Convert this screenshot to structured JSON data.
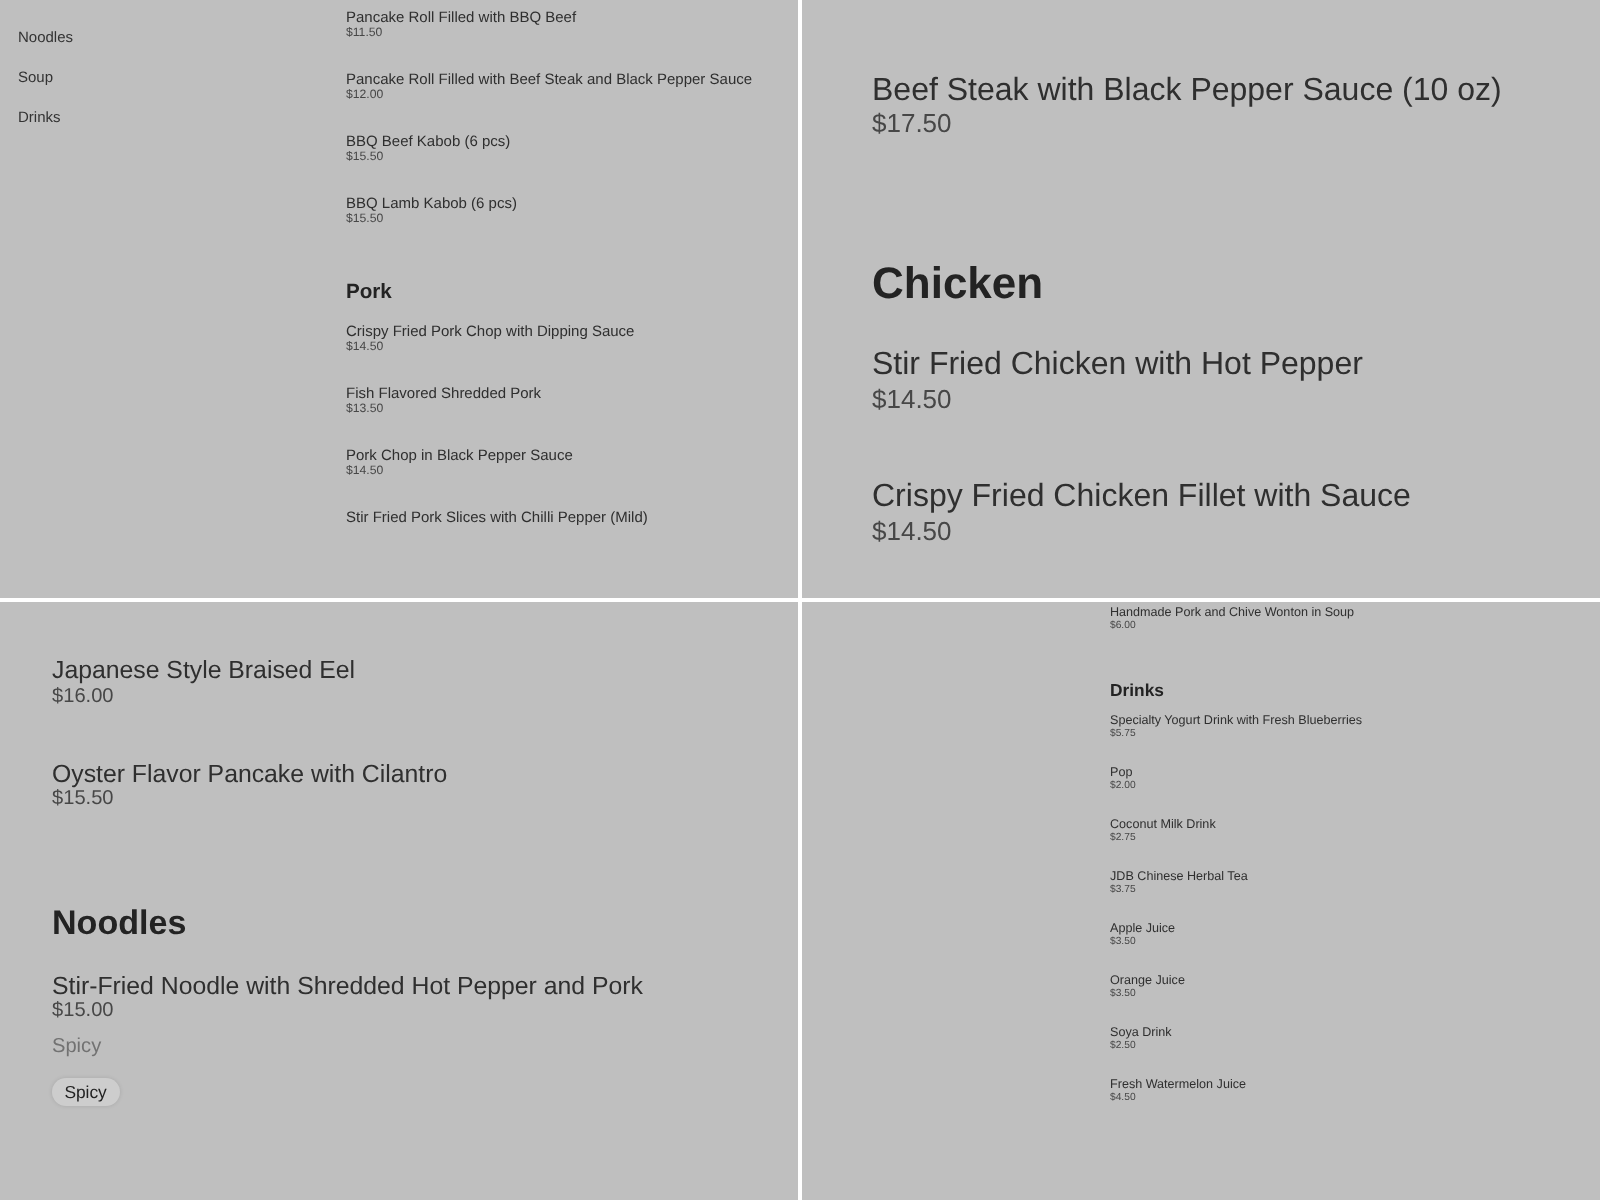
{
  "panels": [
    {
      "sidebar": {
        "items": [
          "Noodles",
          "Soup",
          "Drinks"
        ]
      },
      "sections": [
        {
          "items": [
            {
              "name": "Pancake Roll Filled with BBQ Beef",
              "price": "$11.50"
            },
            {
              "name": "Pancake Roll Filled with Beef Steak and Black Pepper Sauce",
              "price": "$12.00"
            },
            {
              "name": "BBQ Beef Kabob (6 pcs)",
              "price": "$15.50"
            },
            {
              "name": "BBQ Lamb Kabob (6 pcs)",
              "price": "$15.50"
            }
          ]
        },
        {
          "heading": "Pork",
          "items": [
            {
              "name": "Crispy Fried Pork Chop with Dipping Sauce",
              "price": "$14.50"
            },
            {
              "name": "Fish Flavored Shredded Pork",
              "price": "$13.50"
            },
            {
              "name": "Pork Chop in Black Pepper Sauce",
              "price": "$14.50"
            },
            {
              "name": "Stir Fried Pork Slices with Chilli Pepper (Mild)"
            }
          ]
        }
      ]
    },
    {
      "sections": [
        {
          "items": [
            {
              "name": "Beef Steak with Black Pepper Sauce (10 oz)",
              "price": "$17.50"
            }
          ]
        },
        {
          "heading": "Chicken",
          "items": [
            {
              "name": "Stir Fried Chicken with Hot Pepper",
              "price": "$14.50"
            },
            {
              "name": "Crispy Fried Chicken Fillet with Sauce",
              "price": "$14.50"
            }
          ]
        }
      ]
    },
    {
      "sections": [
        {
          "items": [
            {
              "name": "Japanese Style Braised Eel",
              "price": "$16.00"
            },
            {
              "name": "Oyster Flavor Pancake with Cilantro",
              "price": "$15.50"
            }
          ]
        },
        {
          "heading": "Noodles",
          "items": [
            {
              "name": "Stir-Fried Noodle with Shredded Hot Pepper and Pork",
              "price": "$15.00",
              "description": "Spicy",
              "tags": [
                "Spicy"
              ]
            }
          ]
        }
      ]
    },
    {
      "sections": [
        {
          "items": [
            {
              "name": "Handmade Pork and Chive Wonton in Soup",
              "price": "$6.00"
            }
          ]
        },
        {
          "heading": "Drinks",
          "items": [
            {
              "name": "Specialty Yogurt Drink with Fresh Blueberries",
              "price": "$5.75"
            },
            {
              "name": "Pop",
              "price": "$2.00"
            },
            {
              "name": "Coconut Milk Drink",
              "price": "$2.75"
            },
            {
              "name": "JDB Chinese Herbal Tea",
              "price": "$3.75"
            },
            {
              "name": "Apple Juice",
              "price": "$3.50"
            },
            {
              "name": "Orange Juice",
              "price": "$3.50"
            },
            {
              "name": "Soya Drink",
              "price": "$2.50"
            },
            {
              "name": "Fresh Watermelon Juice",
              "price": "$4.50"
            }
          ]
        }
      ]
    }
  ]
}
